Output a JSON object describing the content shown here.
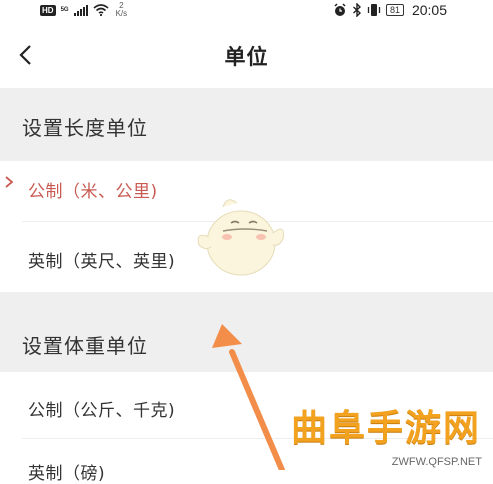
{
  "status_bar": {
    "hd": "HD",
    "network": "5G",
    "speed_value": "2",
    "speed_unit": "K/s",
    "battery": "81",
    "time": "20:05"
  },
  "header": {
    "title": "单位"
  },
  "sections": [
    {
      "title": "设置长度单位",
      "options": [
        {
          "label": "公制（米、公里)",
          "selected": true
        },
        {
          "label": "英制（英尺、英里)",
          "selected": false
        }
      ]
    },
    {
      "title": "设置体重单位",
      "options": [
        {
          "label": "公制（公斤、千克)",
          "selected": false
        },
        {
          "label": "英制（磅)",
          "selected": false
        }
      ]
    }
  ],
  "watermark": {
    "brand": "曲阜手游网",
    "url": "ZWFW.QFSP.NET"
  },
  "colors": {
    "selected_text": "#c95a52",
    "section_bg": "#efefef",
    "annotation_arrow": "#f28d4a",
    "watermark": "#f2a21f"
  }
}
